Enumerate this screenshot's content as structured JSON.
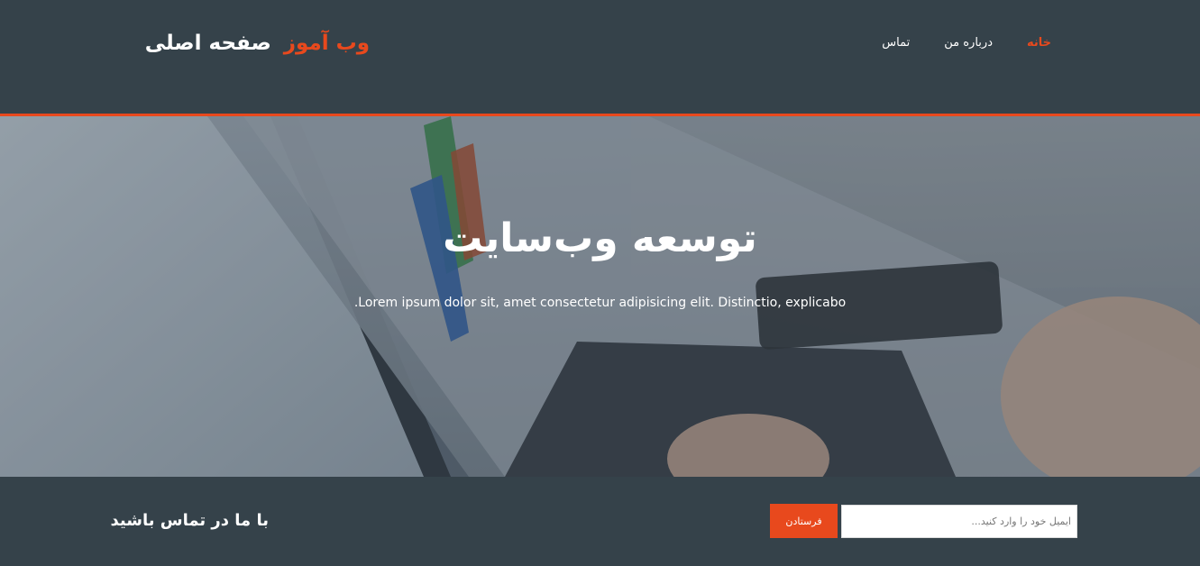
{
  "header": {
    "brand_highlight": "وب آموز",
    "brand_title": "صفحه اصلی",
    "nav": {
      "home": "خانه",
      "about": "درباره من",
      "contact": "تماس"
    }
  },
  "hero": {
    "title": "توسعه وب‌سایت",
    "text": "Lorem ipsum dolor sit, amet consectetur adipisicing elit. Distinctio, explicabo."
  },
  "newsletter": {
    "heading": "با ما در تماس باشید",
    "email_placeholder": "ایمیل خود را وارد کنید...",
    "button_label": "فرستادن"
  },
  "colors": {
    "accent": "#e8491d",
    "dark": "#35424a",
    "text_light": "#ffffff"
  }
}
